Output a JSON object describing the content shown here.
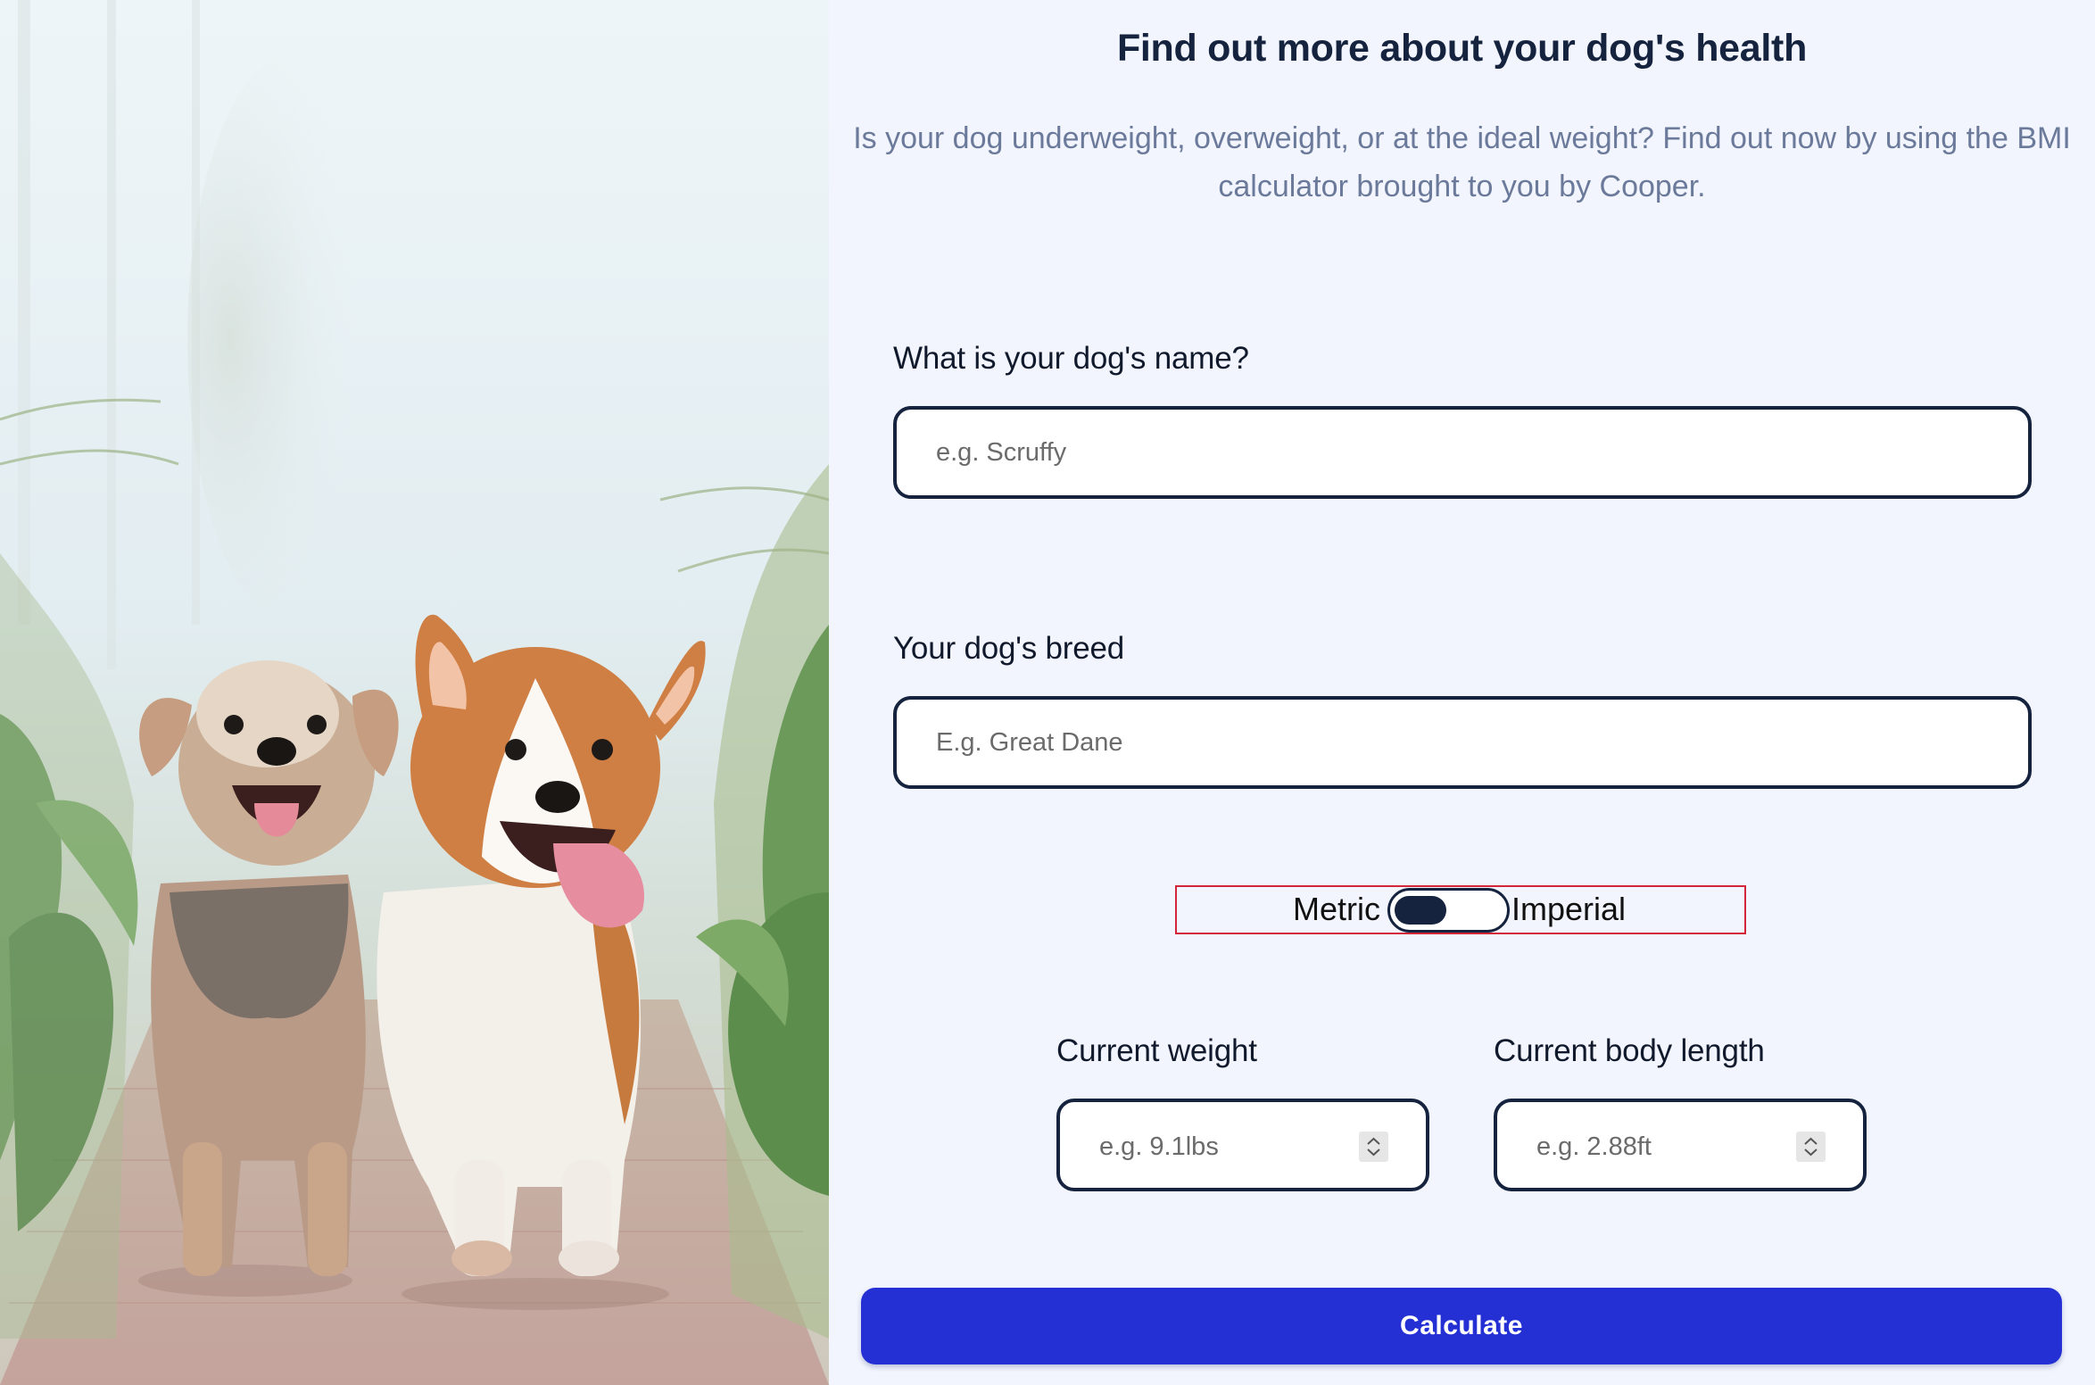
{
  "header": {
    "title": "Find out more about your dog's health",
    "subtitle": "Is your dog underweight, overweight, or at the ideal weight? Find out now by using the BMI calculator brought to you by Cooper."
  },
  "form": {
    "name": {
      "label": "What is your dog's name?",
      "placeholder": "e.g. Scruffy",
      "value": ""
    },
    "breed": {
      "label": "Your dog's breed",
      "placeholder": "E.g. Great Dane",
      "value": ""
    },
    "units": {
      "left_label": "Metric",
      "right_label": "Imperial",
      "selected": "Metric"
    },
    "weight": {
      "label": "Current weight",
      "placeholder": "e.g. 9.1lbs",
      "value": ""
    },
    "length": {
      "label": "Current body length",
      "placeholder": "e.g. 2.88ft",
      "value": ""
    },
    "submit_label": "Calculate"
  },
  "hero_image": {
    "subject": "two dogs running on a brick path",
    "icon": "dogs-photo"
  },
  "colors": {
    "background": "#f2f5fd",
    "navy": "#15233f",
    "subtitle_grey": "#6b7a9a",
    "button_blue": "#2430d4",
    "focus_outline": "#d4263a"
  }
}
